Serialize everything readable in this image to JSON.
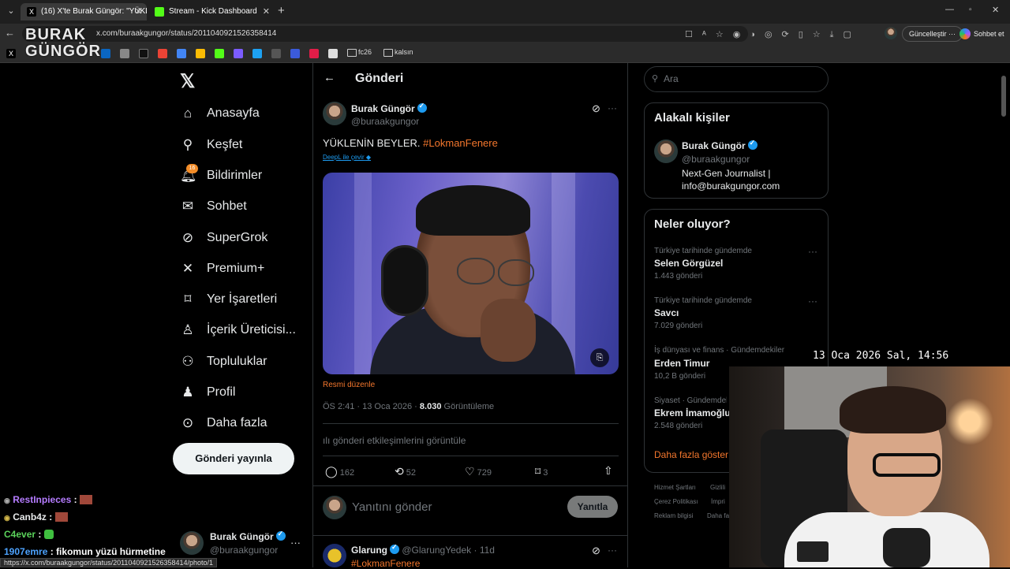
{
  "browser": {
    "tabs": [
      {
        "title": "(16) X'te Burak Güngör: \"YÜKLENİ"
      },
      {
        "title": "Stream - Kick Dashboard"
      }
    ],
    "url": "x.com/buraakgungor/status/2011040921526358414",
    "update_button": "Güncelleştir",
    "copilot_button": "Sohbet et",
    "bookmark_folders": [
      "fc26",
      "kalsın"
    ],
    "status_url": "https://x.com/buraakgungor/status/2011040921526358414/photo/1"
  },
  "watermark": {
    "line1": "BURAK",
    "line2": "GÜNGÖR"
  },
  "nav": {
    "items": [
      {
        "label": "Anasayfa",
        "icon": "home-icon"
      },
      {
        "label": "Keşfet",
        "icon": "search-icon"
      },
      {
        "label": "Bildirimler",
        "icon": "bell-icon"
      },
      {
        "label": "Sohbet",
        "icon": "mail-icon"
      },
      {
        "label": "SuperGrok",
        "icon": "grok-icon"
      },
      {
        "label": "Premium+",
        "icon": "x-logo-icon"
      },
      {
        "label": "Yer İşaretleri",
        "icon": "bookmark-icon"
      },
      {
        "label": "İçerik Üreticisi...",
        "icon": "creator-icon"
      },
      {
        "label": "Topluluklar",
        "icon": "communities-icon"
      },
      {
        "label": "Profil",
        "icon": "person-icon"
      },
      {
        "label": "Daha fazla",
        "icon": "more-circle-icon"
      }
    ],
    "notification_count": "16",
    "post_button": "Gönderi yayınla",
    "account_name": "Burak Güngör",
    "account_handle": "@buraakgungor"
  },
  "main": {
    "header_title": "Gönderi",
    "post": {
      "author": "Burak Güngör",
      "handle": "@buraakgungor",
      "text": "YÜKLENİN BEYLER.",
      "hashtag": "#LokmanFenere",
      "translate_link": "DeepL ile çevir",
      "edit_image": "Resmi düzenle",
      "time": "ÖS 2:41 · 13 Oca 2026 ·",
      "views": "8.030",
      "views_label": "Görüntüleme",
      "engagements": "gönderi etkileşimlerini görüntüle",
      "replies": "162",
      "reposts": "52",
      "likes": "729",
      "bookmarks": "3"
    },
    "reply_placeholder": "Yanıtını gönder",
    "reply_button": "Yanıtla",
    "next_post": {
      "author": "Glarung",
      "handle": "@GlarungYedek · 11d",
      "hashtag": "#LokmanFenere"
    }
  },
  "sidebar": {
    "search_placeholder": "Ara",
    "related_title": "Alakalı kişiler",
    "related_person": {
      "name": "Burak Güngör",
      "handle": "@buraakgungor",
      "bio1": "Next-Gen Journalist |",
      "bio2": "info@burakgungor.com"
    },
    "trends_title": "Neler oluyor?",
    "trends": [
      {
        "context": "Türkiye tarihinde gündemde",
        "name": "Selen Görgüzel",
        "count": "1.443 gönderi"
      },
      {
        "context": "Türkiye tarihinde gündemde",
        "name": "Savcı",
        "count": "7.029 gönderi"
      },
      {
        "context": "İş dünyası ve finans · Gündemdekiler",
        "name": "Erden Timur",
        "count": "10,2 B gönderi"
      },
      {
        "context": "Siyaset · Gündemdeki",
        "name": "Ekrem İmamoğlu",
        "count": "2.548 gönderi"
      }
    ],
    "show_more": "Daha fazla göster",
    "footer": [
      "Hizmet Şartları",
      "Gizlili",
      "Çerez Politikası",
      "İmpri",
      "Reklam bilgisi",
      "Daha fa"
    ]
  },
  "overlay": {
    "datetime": "13 Oca 2026 Sal, 14:56",
    "chat": [
      {
        "user": "RestInpieces",
        "msg": ":",
        "color": "#b57cff"
      },
      {
        "user": "Canb4z",
        "msg": ":",
        "color": "#e7e9ea"
      },
      {
        "user": "C4ever",
        "msg": ":",
        "color": "#5bd35b"
      },
      {
        "user": "1907emre",
        "msg": ": fikomun yüzü hürmetine",
        "color": "#4da3ff"
      }
    ]
  }
}
